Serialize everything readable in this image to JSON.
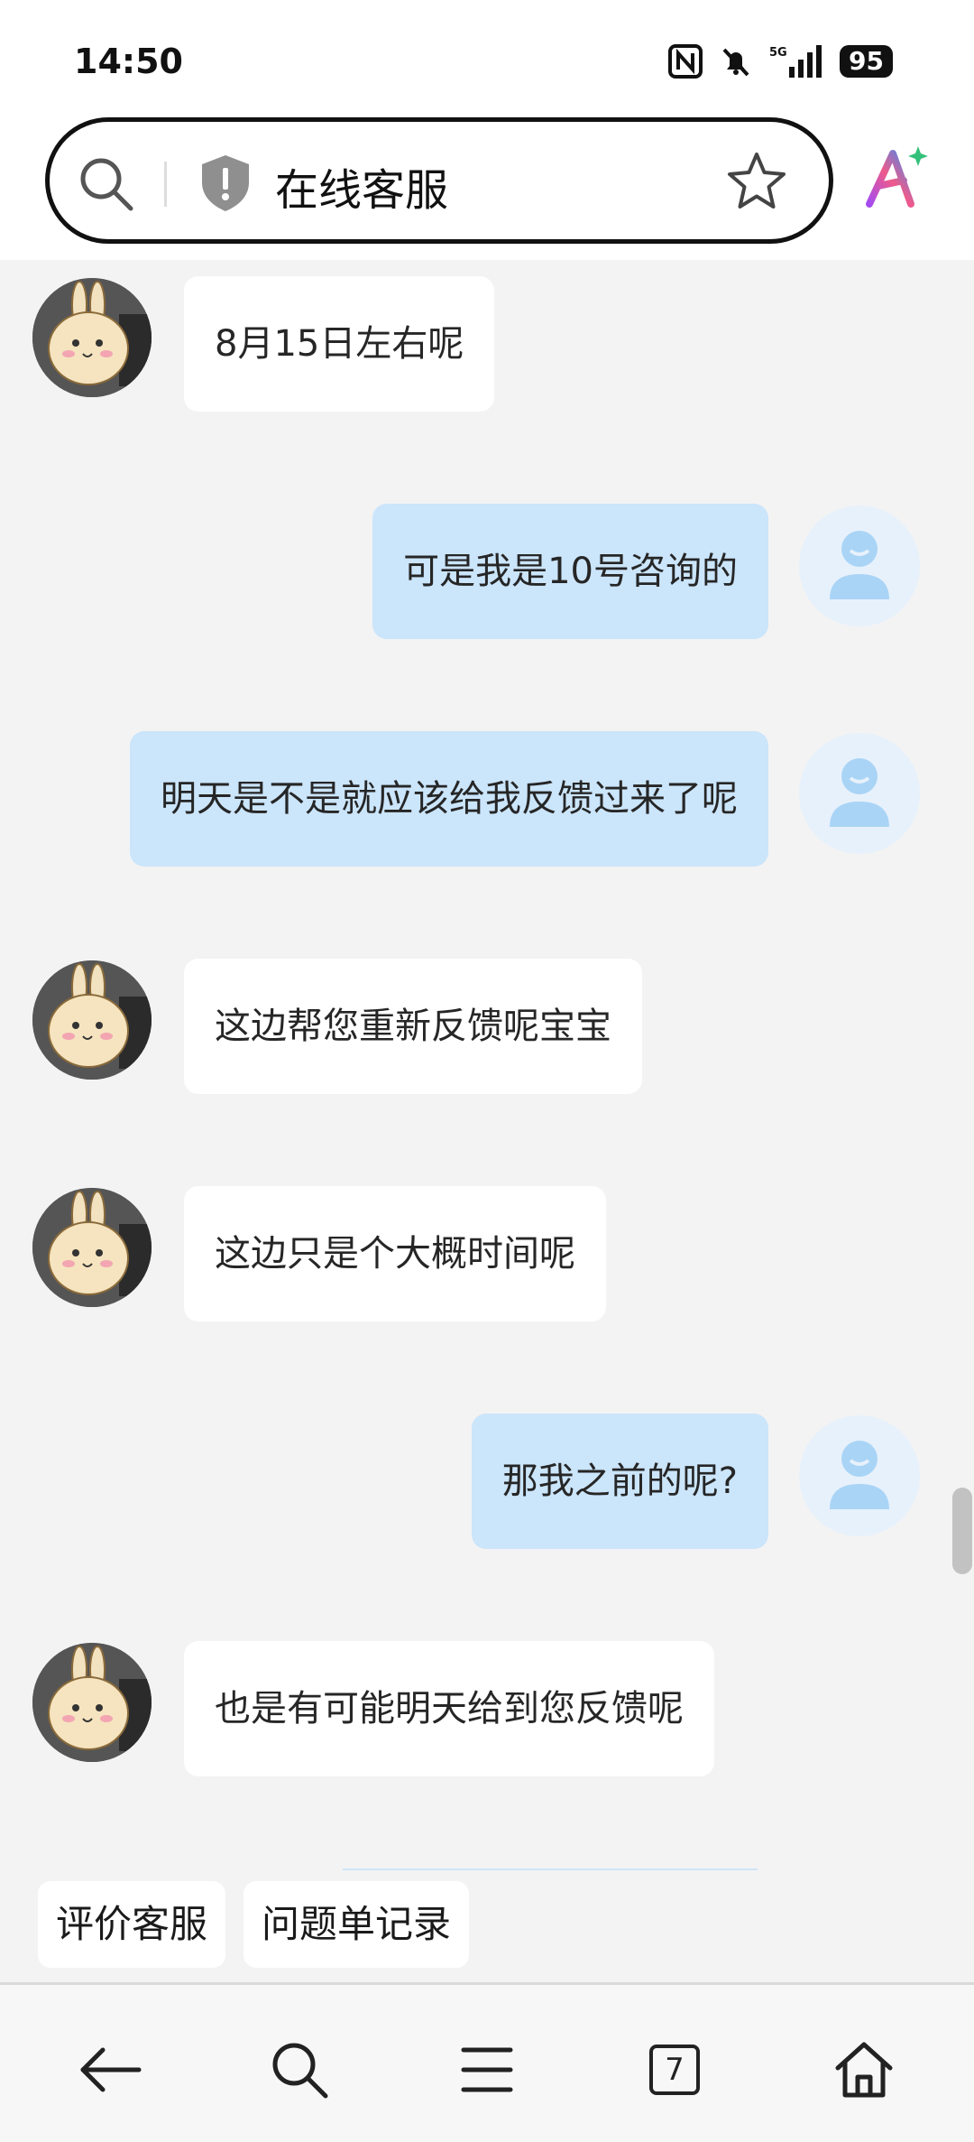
{
  "status": {
    "time": "14:50",
    "battery": "95",
    "network": "5G"
  },
  "header": {
    "title": "在线客服"
  },
  "messages": [
    {
      "sender": "agent",
      "text": "8月15日左右呢"
    },
    {
      "sender": "user",
      "text": "可是我是10号咨询的"
    },
    {
      "sender": "user",
      "text": "明天是不是就应该给我反馈过来了呢"
    },
    {
      "sender": "agent",
      "text": "这边帮您重新反馈呢宝宝"
    },
    {
      "sender": "agent",
      "text": "这边只是个大概时间呢"
    },
    {
      "sender": "user",
      "text": "那我之前的呢?"
    },
    {
      "sender": "agent",
      "text": "也是有可能明天给到您反馈呢"
    }
  ],
  "quick_actions": {
    "rate": "评价客服",
    "tickets": "问题单记录"
  },
  "nav": {
    "tab_count": "7"
  },
  "colors": {
    "user_bubble": "#cbe5fb",
    "agent_bubble": "#ffffff",
    "background": "#f3f3f3"
  }
}
